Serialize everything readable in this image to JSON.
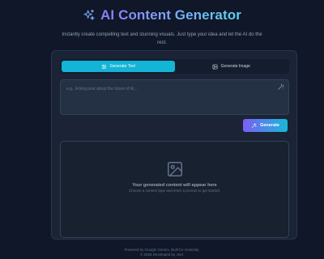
{
  "header": {
    "title": "AI Content Generator",
    "subtitle": "Instantly create compelling text and stunning visuals. Just type your idea and let the AI do the rest."
  },
  "tabs": [
    {
      "label": "Generate Text",
      "active": true,
      "icon": "sliders-icon"
    },
    {
      "label": "Generate Image",
      "active": false,
      "icon": "image-icon"
    }
  ],
  "prompt": {
    "placeholder": "e.g., A blog post about the future of AI..."
  },
  "generate_button": {
    "label": "Generate"
  },
  "output": {
    "title": "Your generated content will appear here",
    "subtitle": "Choose a content type and enter a prompt to get started."
  },
  "footer": {
    "line1": "Powered by Google Gemini. Built for creativity.",
    "line2": "© 2025 Developed by Joel."
  },
  "colors": {
    "background": "#0f1729",
    "accent_cyan": "#13b4d6",
    "accent_purple": "#7c5ff5"
  }
}
